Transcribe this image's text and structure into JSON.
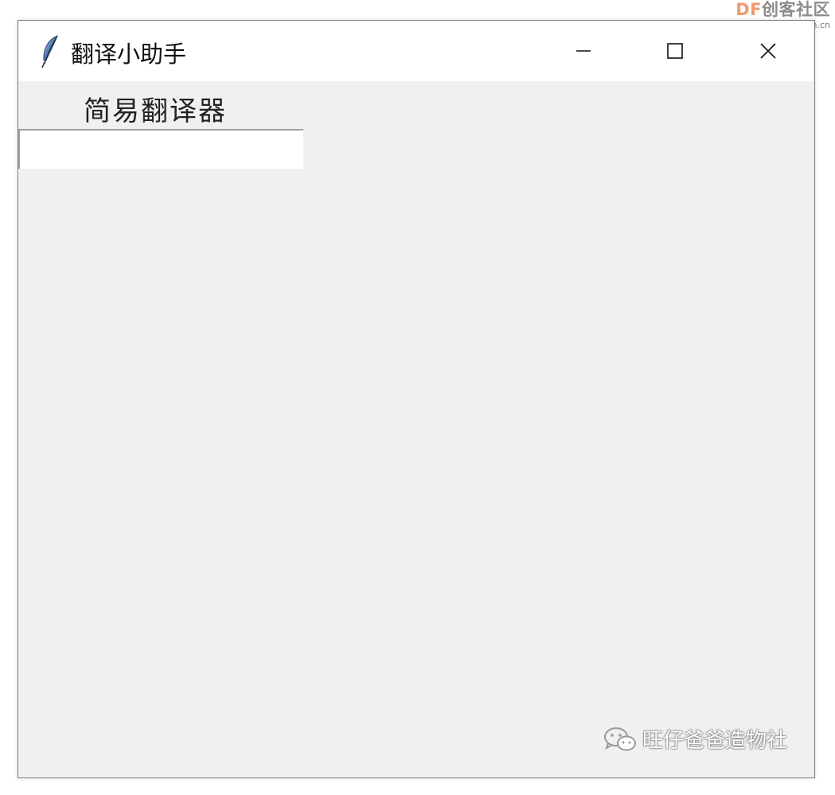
{
  "site_watermark": {
    "brand_prefix": "DF",
    "brand_name": "创客社区",
    "url": "mc.DFRobot.com.cn"
  },
  "window": {
    "title": "翻译小助手",
    "icon": "feather-icon",
    "controls": {
      "minimize": "minimize-icon",
      "maximize": "maximize-icon",
      "close": "close-icon"
    }
  },
  "content": {
    "heading": "简易翻译器",
    "entry_value": ""
  },
  "watermark": {
    "icon": "wechat-icon",
    "text": "旺仔爸爸造物社"
  },
  "colors": {
    "window_bg": "#f0f0f0",
    "titlebar_bg": "#ffffff",
    "brand_orange": "#f0986e"
  }
}
